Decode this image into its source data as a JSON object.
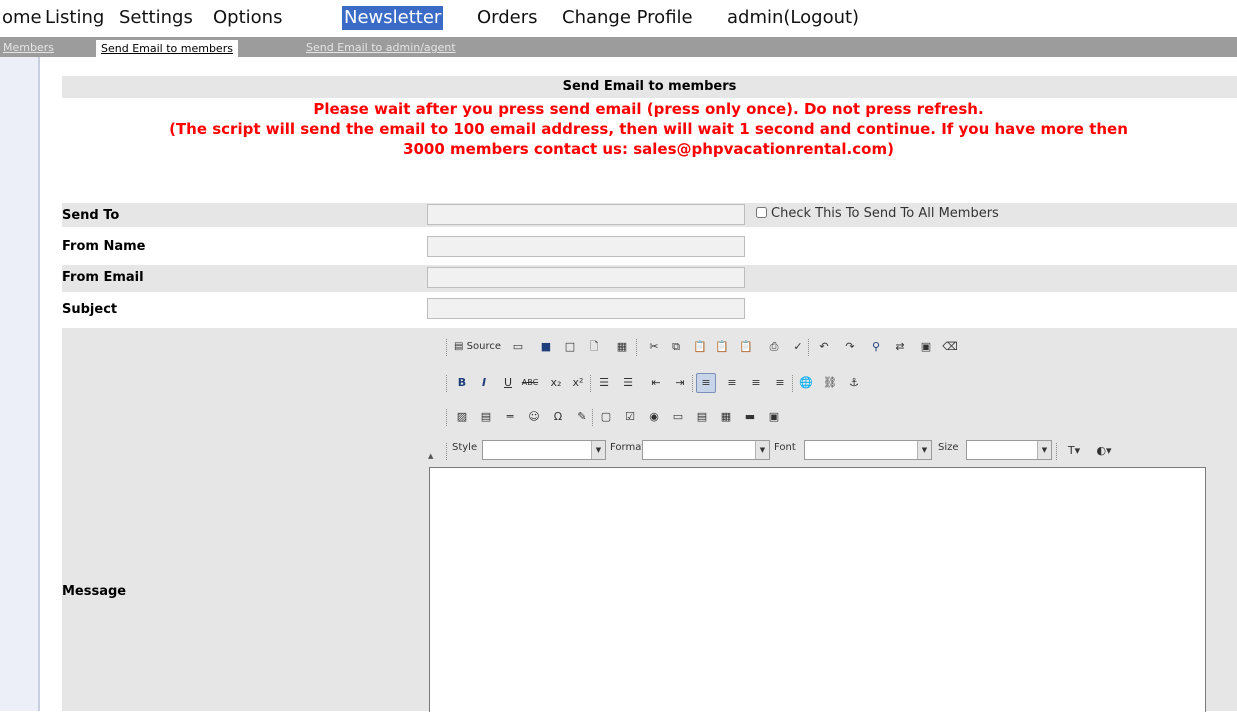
{
  "nav": {
    "items": [
      "ome",
      "Listing",
      "Settings",
      "Options",
      "Newsletter",
      "Orders",
      "Change Profile",
      "admin(Logout)"
    ],
    "active": "Newsletter"
  },
  "subtabs": {
    "items": [
      "Members",
      "Send Email to members",
      "Send Email to admin/agent"
    ],
    "active": "Send Email to members"
  },
  "page": {
    "title": "Send Email to members",
    "warning": "Please wait after you press send email (press only once). Do not press refresh.",
    "notice_line1": "(The script will send the email to 100 email address, then will wait 1 second and continue. If you have more then",
    "notice_line2": "3000 members contact us: sales@phpvacationrental.com)"
  },
  "form": {
    "send_to": {
      "label": "Send To",
      "value": ""
    },
    "send_all_label": "Check This To Send To All Members",
    "send_all_checked": false,
    "from_name": {
      "label": "From Name",
      "value": ""
    },
    "from_email": {
      "label": "From Email",
      "value": ""
    },
    "subject": {
      "label": "Subject",
      "value": ""
    },
    "message": {
      "label": "Message",
      "value": ""
    }
  },
  "editor": {
    "source_label": "Source",
    "style_label": "Style",
    "format_label": "Format",
    "font_label": "Font",
    "size_label": "Size",
    "style_value": "",
    "format_value": "",
    "font_value": "",
    "size_value": "",
    "bold": "B",
    "italic": "I",
    "underline": "U",
    "strike": "ABC",
    "subscript": "x₂",
    "superscript": "x²"
  },
  "colors": {
    "accent": "#3a6bc7",
    "subbar": "#9c9c9c",
    "row_shade": "#e6e6e6",
    "warning_text": "#ff0000"
  }
}
